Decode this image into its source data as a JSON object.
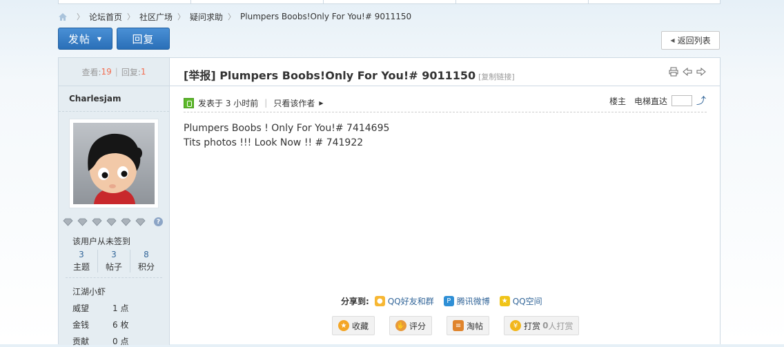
{
  "breadcrumb": {
    "items": [
      "论坛首页",
      "社区广场",
      "疑问求助",
      "Plumpers Boobs!Only For You!# 9011150"
    ]
  },
  "toolbar": {
    "post_label": "发帖",
    "reply_label": "回复",
    "back_label": "返回列表"
  },
  "stats": {
    "views_label": "查看:",
    "views": "19",
    "replies_label": "回复:",
    "replies": "1"
  },
  "author": {
    "name": "Charlesjam",
    "signin_text": "该用户从未签到",
    "counts": [
      {
        "value": "3",
        "label": "主题"
      },
      {
        "value": "3",
        "label": "帖子"
      },
      {
        "value": "8",
        "label": "积分"
      }
    ],
    "rank": "江湖小虾",
    "attrs": [
      {
        "key": "威望",
        "value": "1 点"
      },
      {
        "key": "金钱",
        "value": "6 枚"
      },
      {
        "key": "贡献",
        "value": "0 点"
      }
    ],
    "help_glyph": "?"
  },
  "post": {
    "title": "[举报] Plumpers Boobs!Only For You!# 9011150",
    "copy_link": "[复制链接]",
    "posted_at": "发表于 3 小时前",
    "only_author": "只看该作者",
    "floor": "楼主",
    "elevator": "电梯直达",
    "body_lines": [
      "Plumpers Boobs ! Only For You!# 7414695",
      "Tits photos !!! Look Now !! # 741922"
    ]
  },
  "share": {
    "label": "分享到:",
    "items": [
      "QQ好友和群",
      "腾讯微博",
      "QQ空间"
    ]
  },
  "actions": {
    "favorite": "收藏",
    "rate": "评分",
    "taotie": "淘帖",
    "tip": "打赏",
    "tip_count": "0",
    "tip_suffix": "人打赏"
  },
  "colors": {
    "accent_blue": "#2a6fb8",
    "count_red": "#f26c4f",
    "sidebar_bg": "#e5edf2"
  }
}
